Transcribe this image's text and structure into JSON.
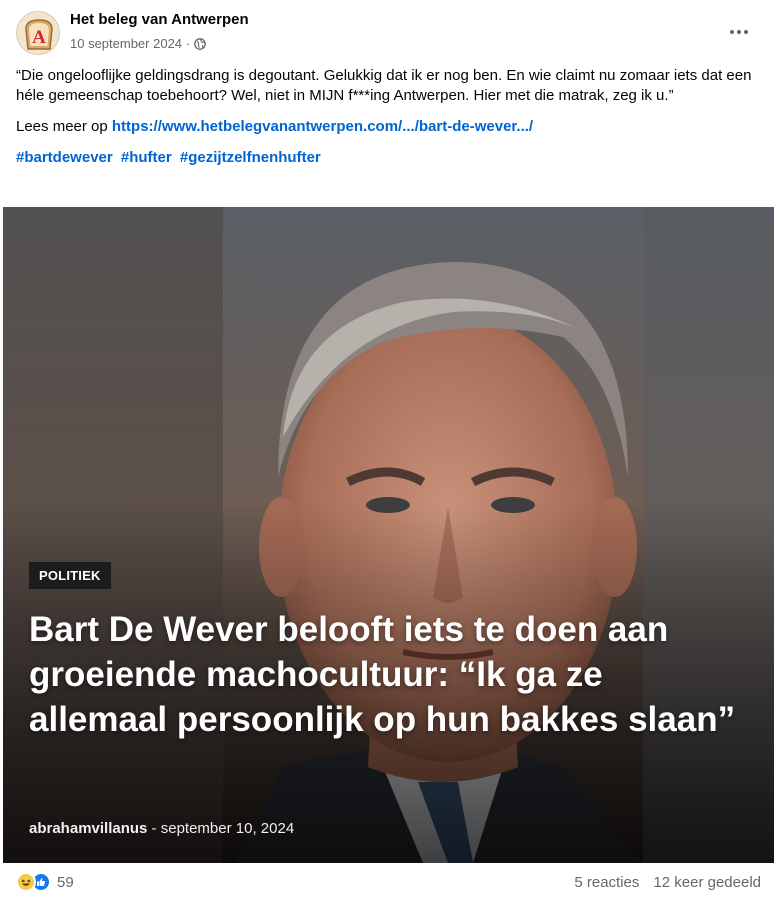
{
  "post": {
    "page_name": "Het beleg van Antwerpen",
    "date": "10 september 2024",
    "meta_separator": "·",
    "quote": "“Die ongelooflijke geldingsdrang is degoutant. Gelukkig dat ik er nog ben. En wie claimt nu zomaar iets dat een héle gemeenschap toebehoort? Wel, niet in MIJN f***ing Antwerpen. Hier met die matrak, zeg ik u.”",
    "read_more_prefix": "Lees meer op ",
    "read_more_link": "https://www.hetbelegvanantwerpen.com/.../bart-de-wever.../",
    "hashtags": [
      "#bartdewever",
      "#hufter",
      "#gezijtzelfnenhufter"
    ]
  },
  "article": {
    "category": "POLITIEK",
    "headline": "Bart De Wever belooft iets te doen aan groeiende machocultuur: “Ik ga ze allemaal persoonlijk op hun bakkes slaan”",
    "author": "abrahamvillanus",
    "date_sep": " - ",
    "date": "september 10, 2024"
  },
  "footer": {
    "reaction_count": "59",
    "comments": "5 reacties",
    "shares": "12 keer gedeeld"
  },
  "colors": {
    "link": "#0064d1",
    "secondary_text": "#65676b",
    "like_blue": "#1877f2",
    "haha_yellow": "#f7c948"
  },
  "icons": {
    "avatar": "bread-slice-logo-icon",
    "privacy": "globe-icon",
    "more": "more-options-icon",
    "haha": "haha-reaction-icon",
    "like": "like-reaction-icon"
  }
}
